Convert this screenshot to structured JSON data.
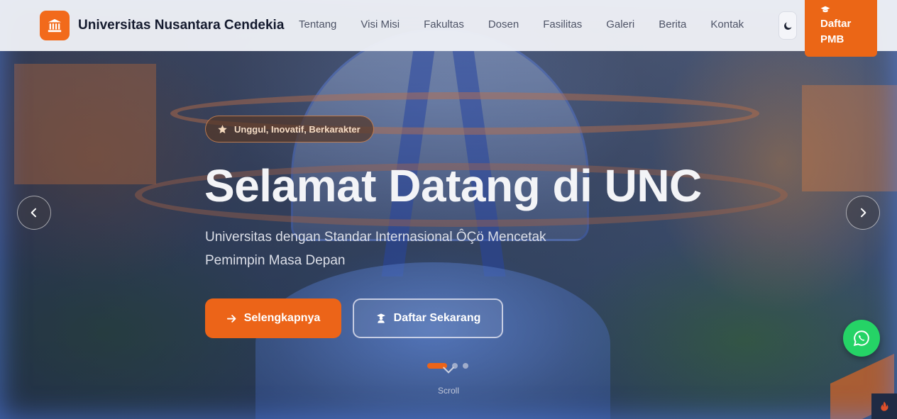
{
  "brand": {
    "name": "Universitas Nusantara Cendekia",
    "logo_icon": "university-building-icon"
  },
  "nav": {
    "links": [
      "Tentang",
      "Visi Misi",
      "Fakultas",
      "Dosen",
      "Fasilitas",
      "Galeri",
      "Berita",
      "Kontak"
    ],
    "theme_toggle_icon": "moon-icon",
    "pmb_button": {
      "icon": "graduation-cap-icon",
      "label": "Daftar PMB"
    }
  },
  "hero": {
    "tagline": "Unggul, Inovatif, Berkarakter",
    "tagline_icon": "star-icon",
    "title": "Selamat Datang di UNC",
    "subtitle": "Universitas dengan Standar Internasional ÔÇö Mencetak Pemimpin Masa Depan",
    "primary_button": {
      "label": "Selengkapnya",
      "icon": "arrow-right-icon"
    },
    "secondary_button": {
      "label": "Daftar Sekarang",
      "icon": "graduate-icon"
    },
    "slides_count": 3,
    "active_slide": 1,
    "scroll_label": "Scroll"
  },
  "colors": {
    "accent": "#ec6418",
    "whatsapp": "#25d366",
    "navbar_bg": "#eef0f6"
  }
}
